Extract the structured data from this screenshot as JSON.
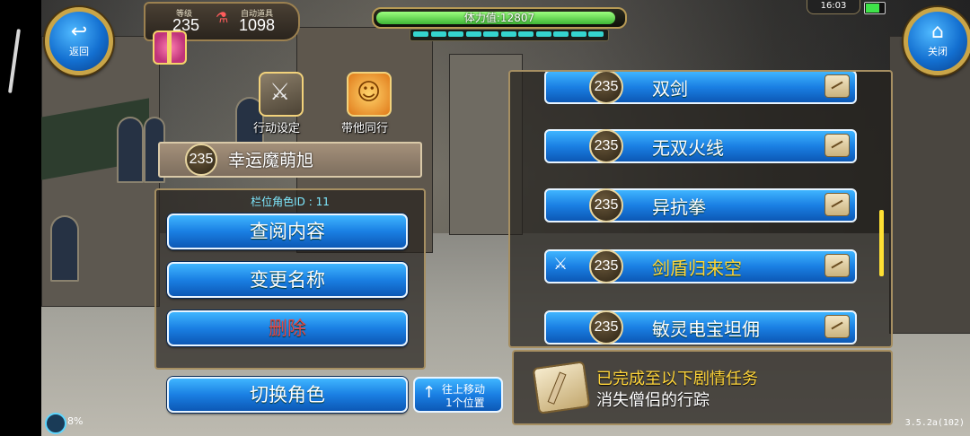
{
  "nav": {
    "back_label": "返回",
    "close_label": "关闭"
  },
  "status": {
    "level_caption": "等级",
    "level_value": "235",
    "auto_caption": "自动道具",
    "auto_value": "1098",
    "stamina_label": "体力值:12807",
    "stamina_fraction": 0.97,
    "stamina_segments_total": 11,
    "stamina_segments_filled": 11,
    "clock": "16:03",
    "battery_fraction": 0.85
  },
  "actions": {
    "action_settings_label": "行动设定",
    "companion_label": "带他同行"
  },
  "character": {
    "level": "235",
    "name": "幸运魔萌旭",
    "slot_id_label": "栏位角色ID : 11"
  },
  "menu": {
    "view_label": "查阅内容",
    "rename_label": "变更名称",
    "delete_label": "删除",
    "switch_label": "切换角色",
    "move_up_line1": "往上移动",
    "move_up_line2": "1个位置"
  },
  "skills": [
    {
      "level": "235",
      "name": "双剑",
      "active": false
    },
    {
      "level": "235",
      "name": "无双火线",
      "active": false
    },
    {
      "level": "235",
      "name": "异抗拳",
      "active": false
    },
    {
      "level": "235",
      "name": "剑盾归来空",
      "active": true
    },
    {
      "level": "235",
      "name": "敏灵电宝坦佣",
      "active": false
    }
  ],
  "quest": {
    "title": "已完成至以下剧情任务",
    "name": "消失僧侣的行踪"
  },
  "footer": {
    "network_pct": "8%",
    "version": "3.5.2a(102)"
  },
  "colors": {
    "button_blue": "#1a7fe3",
    "gold_border": "#c9a548",
    "highlight_yellow": "#ffd53a",
    "delete_red": "#e14848"
  }
}
